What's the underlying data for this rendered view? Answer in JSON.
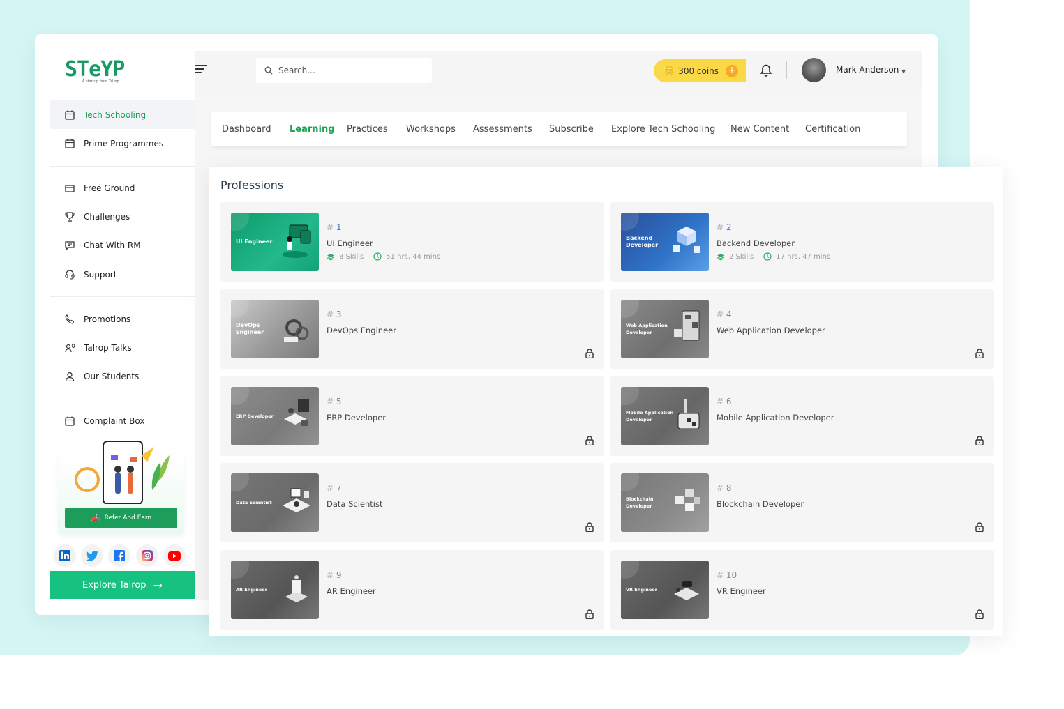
{
  "brand": {
    "logo": "STeYP",
    "tagline": "A startup from Talrop"
  },
  "search": {
    "placeholder": "Search..."
  },
  "coins": {
    "label": "300 coins",
    "plus": "+"
  },
  "user": {
    "name": "Mark Anderson"
  },
  "sidebar": {
    "items": [
      {
        "label": "Tech Schooling",
        "active": true,
        "icon": "calendar-icon"
      },
      {
        "label": "Prime Programmes",
        "icon": "calendar-icon"
      },
      {
        "label": "Free Ground",
        "icon": "wallet-icon"
      },
      {
        "label": "Challenges",
        "icon": "trophy-icon"
      },
      {
        "label": "Chat With RM",
        "icon": "chat-icon"
      },
      {
        "label": "Support",
        "icon": "headset-icon"
      },
      {
        "label": "Promotions",
        "icon": "phone-icon"
      },
      {
        "label": "Talrop Talks",
        "icon": "talk-icon"
      },
      {
        "label": "Our Students",
        "icon": "user-icon"
      },
      {
        "label": "Complaint Box",
        "icon": "calendar-icon"
      }
    ],
    "refer_label": "Refer And Earn",
    "explore_label": "Explore Talrop",
    "socials": [
      "linkedin-icon",
      "twitter-icon",
      "facebook-icon",
      "instagram-icon",
      "youtube-icon"
    ]
  },
  "tabs": [
    {
      "label": "Dashboard"
    },
    {
      "label": "Learning",
      "active": true
    },
    {
      "label": "Practices"
    },
    {
      "label": "Workshops"
    },
    {
      "label": "Assessments"
    },
    {
      "label": "Subscribe"
    },
    {
      "label": "Explore Tech Schooling"
    },
    {
      "label": "New Content"
    },
    {
      "label": "Certification"
    }
  ],
  "professions": {
    "title": "Professions",
    "items": [
      {
        "number": "1",
        "title": "UI Engineer",
        "thumb_label": "UI Engineer",
        "skills": "8 Skills",
        "time": "51 hrs, 44 mins",
        "locked": false
      },
      {
        "number": "2",
        "title": "Backend Developer",
        "thumb_label": "Backend Developer",
        "skills": "2 Skills",
        "time": "17 hrs, 47 mins",
        "locked": false
      },
      {
        "number": "3",
        "title": "DevOps Engineer",
        "thumb_label": "DevOps Engineer",
        "locked": true
      },
      {
        "number": "4",
        "title": "Web Application Developer",
        "thumb_label": "Web Application Developer",
        "locked": true
      },
      {
        "number": "5",
        "title": "ERP Developer",
        "thumb_label": "ERP Developer",
        "locked": true
      },
      {
        "number": "6",
        "title": "Mobile Application Developer",
        "thumb_label": "Mobile Application Developer",
        "locked": true
      },
      {
        "number": "7",
        "title": "Data Scientist",
        "thumb_label": "Data Scientist",
        "locked": true
      },
      {
        "number": "8",
        "title": "Blockchain Developer",
        "thumb_label": "Blockchain Developer",
        "locked": true
      },
      {
        "number": "9",
        "title": "AR Engineer",
        "thumb_label": "AR Engineer",
        "locked": true
      },
      {
        "number": "10",
        "title": "VR Engineer",
        "thumb_label": "VR Engineer",
        "locked": true
      }
    ]
  },
  "colors": {
    "accent": "#1d9d5a",
    "explore": "#17c180",
    "coins": "#fbd846",
    "teal_bg": "#d3f6f5"
  }
}
